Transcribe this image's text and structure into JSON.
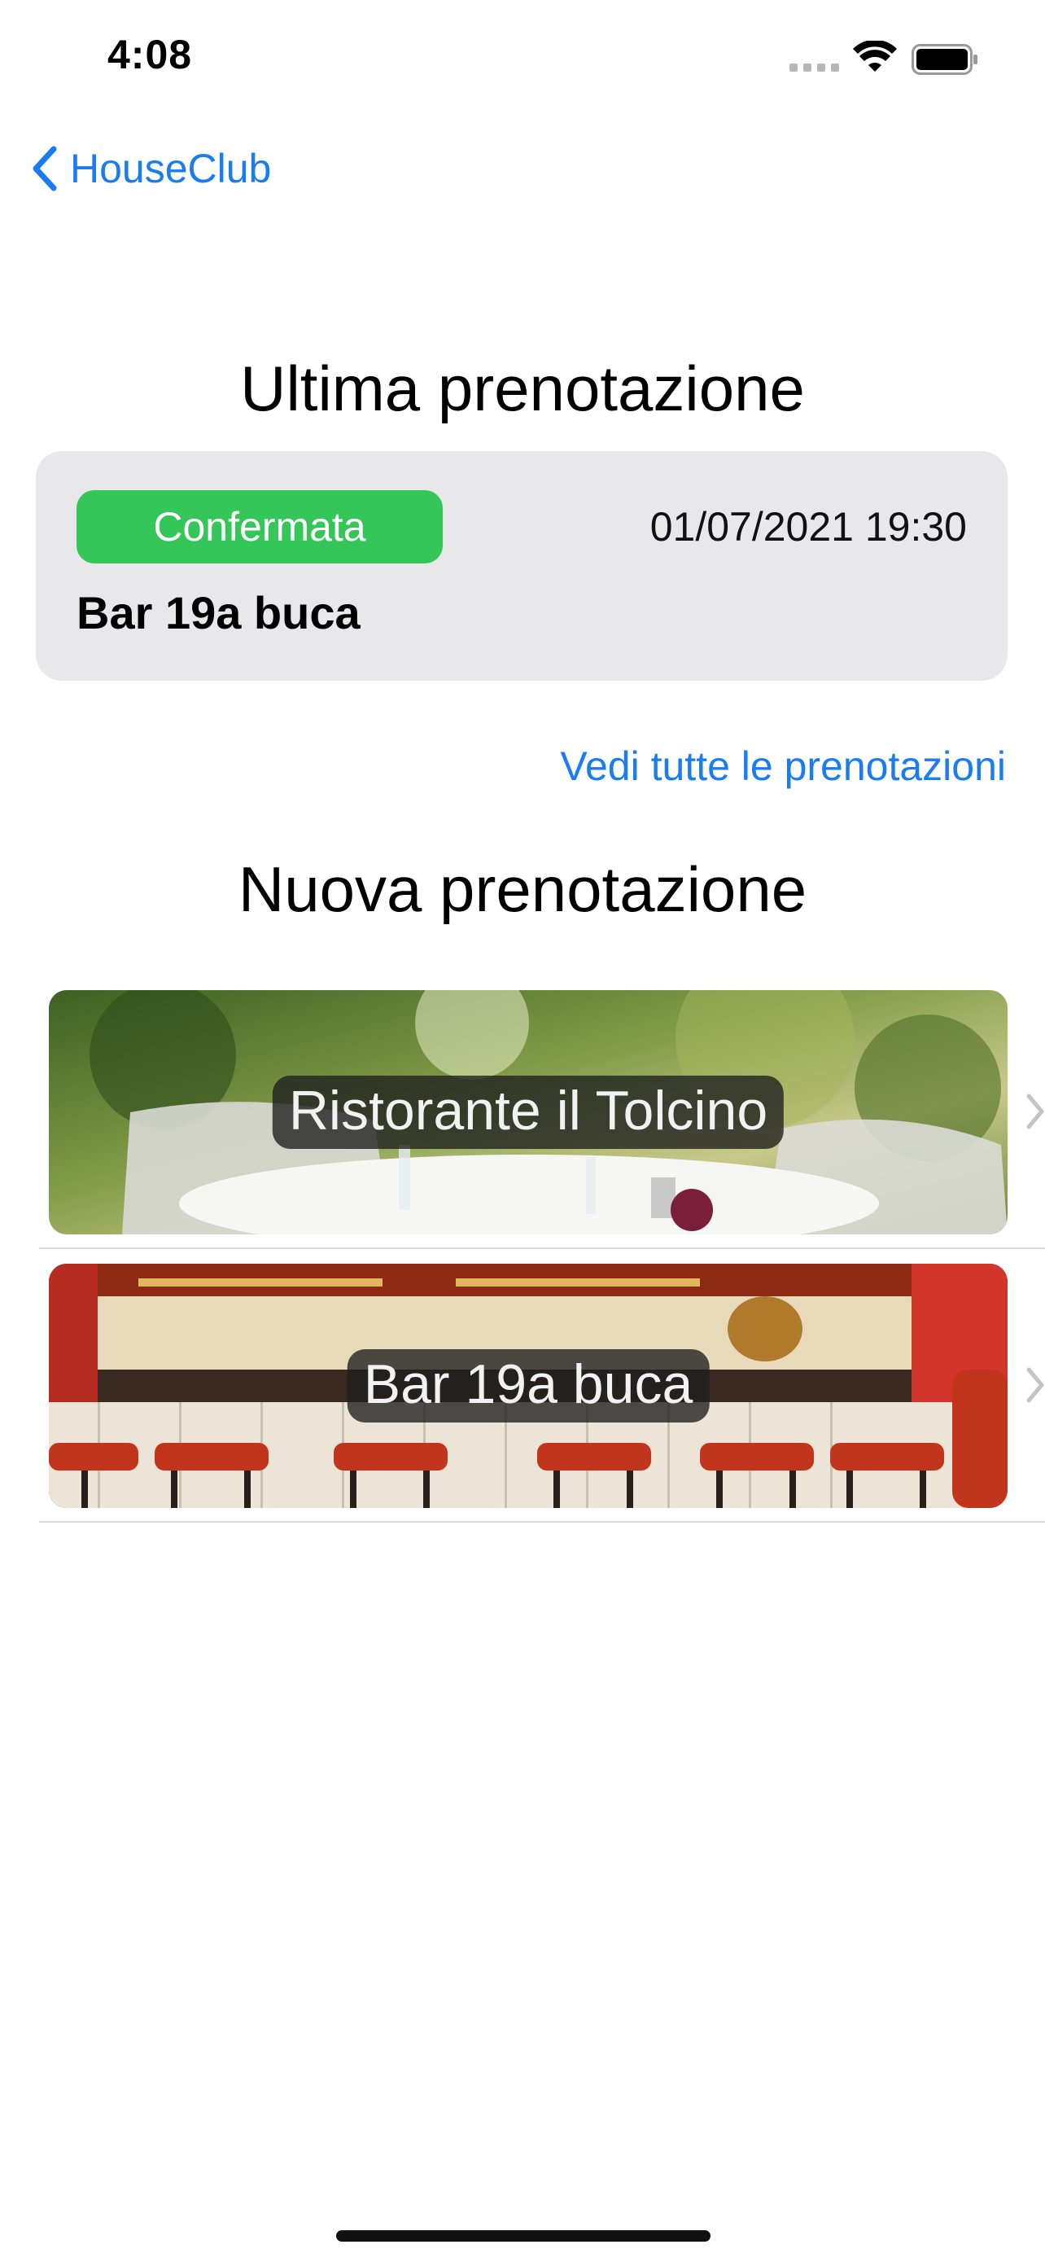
{
  "status_bar": {
    "time": "4:08"
  },
  "nav": {
    "back_label": "HouseClub"
  },
  "last_reservation": {
    "heading": "Ultima prenotazione",
    "status": "Confermata",
    "status_color": "#35c659",
    "datetime": "01/07/2021 19:30",
    "venue": "Bar 19a buca"
  },
  "see_all_link": "Vedi tutte le prenotazioni",
  "new_reservation": {
    "heading": "Nuova prenotazione",
    "venues": [
      {
        "name": "Ristorante il Tolcino",
        "image": "restaurant-terrace-photo"
      },
      {
        "name": "Bar 19a buca",
        "image": "bar-counter-photo"
      }
    ]
  },
  "colors": {
    "accent": "#1a7cf2",
    "card_background": "#e8e8ea"
  }
}
